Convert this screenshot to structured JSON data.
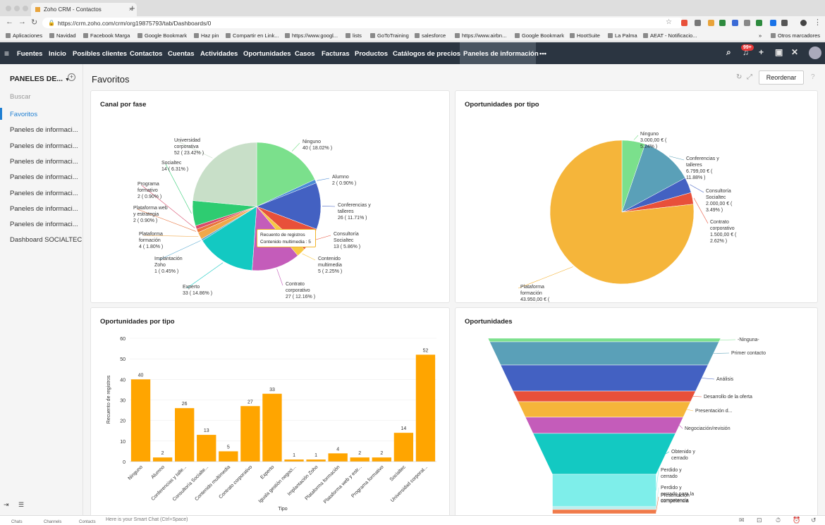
{
  "browser": {
    "tab_title": "Zoho CRM - Contactos",
    "url": "https://crm.zoho.com/crm/org19875793/tab/Dashboards/0",
    "bookmarks": [
      "Aplicaciones",
      "Navidad",
      "Facebook Marga",
      "Google Bookmark",
      "Haz pin",
      "Compartir en Link...",
      "https://www.googl...",
      "lists",
      "GoToTraining",
      "salesforce",
      "https://www.airbn...",
      "Google Bookmark",
      "HootSuite",
      "La Palma",
      "AEAT - Notificacio..."
    ],
    "more_bookmarks": "»",
    "other_bookmarks": "Otros marcadores"
  },
  "topnav": {
    "items": [
      "Fuentes",
      "Inicio",
      "Posibles clientes",
      "Contactos",
      "Cuentas",
      "Actividades",
      "Oportunidades",
      "Casos",
      "Facturas",
      "Productos",
      "Catálogos de precios",
      "Paneles de información"
    ],
    "more": "•••",
    "notifications": "99+",
    "colors": {
      "bg": "#2b3541",
      "active": "#4a5561"
    }
  },
  "sidebar": {
    "header": "PANELES DE...",
    "search": "Buscar",
    "items": [
      "Favoritos",
      "Paneles de informaci...",
      "Paneles de informaci...",
      "Paneles de informaci...",
      "Paneles de informaci...",
      "Paneles de informaci...",
      "Paneles de informaci...",
      "Paneles de informaci...",
      "Dashboard SOCIALTEC"
    ]
  },
  "page": {
    "title": "Favoritos",
    "reorder": "Reordenar"
  },
  "cards": {
    "c1": {
      "title": "Canal por fase",
      "tooltip_title": "Recuento de registros",
      "tooltip_value": "Contenido multimedia : 5"
    },
    "c2": {
      "title": "Oportunidades por tipo"
    },
    "c3": {
      "title": "Oportunidades por tipo",
      "xlabel": "Tipo",
      "ylabel": "Recuento de registros"
    },
    "c4": {
      "title": "Oportunidades"
    }
  },
  "chart_data": [
    {
      "type": "pie",
      "title": "Canal por fase",
      "slices": [
        {
          "label": "Ninguno",
          "value": 40,
          "pct": "18.02%",
          "color": "#7be08c"
        },
        {
          "label": "Alumno",
          "value": 2,
          "pct": "0.90%",
          "color": "#4a8ad6"
        },
        {
          "label": "Conferencias y talleres",
          "value": 26,
          "pct": "11.71%",
          "color": "#4361c2"
        },
        {
          "label": "Consultoría Socialtec",
          "value": 13,
          "pct": "5.86%",
          "color": "#e8503a"
        },
        {
          "label": "Contenido multimedia",
          "value": 5,
          "pct": "2.25%",
          "color": "#f7c843"
        },
        {
          "label": "Contrato corporativo",
          "value": 27,
          "pct": "12.16%",
          "color": "#c45cba"
        },
        {
          "label": "Experto",
          "value": 33,
          "pct": "14.86%",
          "color": "#13c9c2"
        },
        {
          "label": "Implantación Zoho",
          "value": 1,
          "pct": "0.45%",
          "color": "#58a9d0"
        },
        {
          "label": "Plataforma formación",
          "value": 4,
          "pct": "1.80%",
          "color": "#f0a84a"
        },
        {
          "label": "Plataforma web y estrategia",
          "value": 2,
          "pct": "0.90%",
          "color": "#e8723a"
        },
        {
          "label": "Programa formativo",
          "value": 2,
          "pct": "0.90%",
          "color": "#d84b6b"
        },
        {
          "label": "Socialtec",
          "value": 14,
          "pct": "6.31%",
          "color": "#2ecc71"
        },
        {
          "label": "Universidad corporativa",
          "value": 52,
          "pct": "23.42%",
          "color": "#c8dfc8"
        }
      ],
      "labels": [
        {
          "lines": [
            "Ninguno",
            "40 ( 18.02% )"
          ]
        },
        {
          "lines": [
            "Alumno",
            "2 ( 0.90% )"
          ]
        },
        {
          "lines": [
            "Conferencias y",
            "talleres",
            "26 ( 11.71% )"
          ]
        },
        {
          "lines": [
            "Consultoría",
            "Socialtec",
            "13 ( 5.86% )"
          ]
        },
        {
          "lines": [
            "Contenido",
            "multimedia",
            "5 ( 2.25% )"
          ]
        },
        {
          "lines": [
            "Contrato",
            "corporativo",
            "27 ( 12.16% )"
          ]
        },
        {
          "lines": [
            "Experto",
            "33 ( 14.86% )"
          ]
        },
        {
          "lines": [
            "Implantación",
            "Zoho",
            "1 ( 0.45% )"
          ]
        },
        {
          "lines": [
            "Plataforma",
            "formación",
            "4 ( 1.80% )"
          ]
        },
        {
          "lines": [
            "Plataforma web",
            "y estrategia",
            "2 ( 0.90% )"
          ]
        },
        {
          "lines": [
            "Programa",
            "formativo",
            "2 ( 0.90% )"
          ]
        },
        {
          "lines": [
            "Socialtec",
            "14 ( 6.31% )"
          ]
        },
        {
          "lines": [
            "Universidad",
            "corporativa",
            "52 ( 23.42% )"
          ]
        }
      ]
    },
    {
      "type": "pie",
      "title": "Oportunidades por tipo",
      "slices": [
        {
          "label": "Ninguno",
          "value": 3000,
          "color": "#7be08c"
        },
        {
          "label": "Conferencias y talleres",
          "value": 6799,
          "color": "#5aa0b8"
        },
        {
          "label": "Consultoría Socialtec",
          "value": 2000,
          "color": "#4361c2"
        },
        {
          "label": "Contrato corporativo",
          "value": 1500,
          "color": "#e8503a"
        },
        {
          "label": "Plataforma formación",
          "value": 43950,
          "color": "#f5b53a"
        }
      ],
      "labels": [
        {
          "lines": [
            "Ninguno",
            "3.000,00 € (",
            "5.24% )"
          ]
        },
        {
          "lines": [
            "Conferencias y",
            "talleres",
            "6.799,00 € (",
            "11.88% )"
          ]
        },
        {
          "lines": [
            "Consultoría",
            "Socialtec",
            "2.000,00 € (",
            "3.49% )"
          ]
        },
        {
          "lines": [
            "Contrato",
            "corporativo",
            "1.500,00 € (",
            "2.62% )"
          ]
        },
        {
          "lines": [
            "Plataforma",
            "formación",
            "43.950,00 € (",
            "76.77% )"
          ]
        }
      ]
    },
    {
      "type": "bar",
      "title": "Oportunidades por tipo",
      "xlabel": "Tipo",
      "ylabel": "Recuento de registros",
      "ylim": [
        0,
        60
      ],
      "yticks": [
        0,
        10,
        20,
        30,
        40,
        50,
        60
      ],
      "color": "#ffa500",
      "categories": [
        "Ninguno",
        "Alumno",
        "Conferencias y talle...",
        "Consultoría Socialte...",
        "Contenido multimedia",
        "Contrato corporativo",
        "Experto",
        "Iguala gestión negoci...",
        "Implantación Zoho",
        "Plataforma formación",
        "Plataforma web y estr...",
        "Programa formativo",
        "Socialtec",
        "Universidad corporat..."
      ],
      "values": [
        40,
        2,
        26,
        13,
        5,
        27,
        33,
        1,
        1,
        4,
        2,
        2,
        14,
        52
      ]
    },
    {
      "type": "funnel",
      "title": "Oportunidades",
      "stages": [
        {
          "label": "-Ninguna-",
          "color": "#7be08c"
        },
        {
          "label": "Primer contacto",
          "color": "#5aa0b8"
        },
        {
          "label": "Análisis",
          "color": "#4361c2"
        },
        {
          "label": "Desarrollo de la oferta",
          "color": "#e8503a"
        },
        {
          "label": "Presentación d...",
          "color": "#f5b53a"
        },
        {
          "label": "Negociación/revisión",
          "color": "#c45cba"
        },
        {
          "label": "Obtenido y cerrado",
          "color": "#13c9c2"
        },
        {
          "label": "Perdido y cerrado",
          "color": "#7eeeea"
        },
        {
          "label": "Perdido y cerrado para la competencia",
          "color": "#b8ecec"
        },
        {
          "label": "Presentación competencia",
          "color": "#f07a4a"
        }
      ]
    }
  ],
  "bottom": {
    "chats": "Chats",
    "channels": "Channels",
    "contacts": "Contacts",
    "smartchat": "Here is your Smart Chat (Ctrl+Space)"
  }
}
